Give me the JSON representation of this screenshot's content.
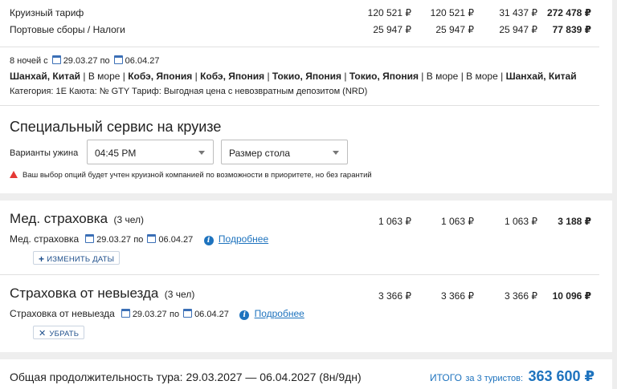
{
  "tariff_rows": [
    {
      "label": "Круизный тариф",
      "values": [
        "120 521 ₽",
        "120 521 ₽",
        "31 437 ₽"
      ],
      "total": "272 478 ₽"
    },
    {
      "label": "Портовые сборы / Налоги",
      "values": [
        "25 947 ₽",
        "25 947 ₽",
        "25 947 ₽"
      ],
      "total": "77 839 ₽"
    }
  ],
  "cruise": {
    "nights_prefix": "8 ночей с",
    "date_from": "29.03.27",
    "by": "по",
    "date_to": "06.04.27",
    "route": [
      {
        "text": "Шанхай, Китай",
        "bold": true
      },
      {
        "text": " | ",
        "bold": false
      },
      {
        "text": "В море",
        "bold": false
      },
      {
        "text": " | ",
        "bold": false
      },
      {
        "text": "Кобэ, Япония",
        "bold": true
      },
      {
        "text": " | ",
        "bold": false
      },
      {
        "text": "Кобэ, Япония",
        "bold": true
      },
      {
        "text": " | ",
        "bold": false
      },
      {
        "text": "Токио, Япония",
        "bold": true
      },
      {
        "text": " | ",
        "bold": false
      },
      {
        "text": "Токио, Япония",
        "bold": true
      },
      {
        "text": " | ",
        "bold": false
      },
      {
        "text": "В море",
        "bold": false
      },
      {
        "text": " | ",
        "bold": false
      },
      {
        "text": "В море",
        "bold": false
      },
      {
        "text": " | ",
        "bold": false
      },
      {
        "text": "Шанхай, Китай",
        "bold": true
      }
    ],
    "details": "Категория: 1E  Каюта: № GTY  Тариф: Выгодная цена с невозвратным депозитом (NRD)"
  },
  "special_service": {
    "title": "Специальный сервис на круизе",
    "dinner_label": "Варианты ужина",
    "dinner_value": "04:45 PM",
    "table_value": "Размер стола",
    "warning": "Ваш выбор опций будет учтен круизной компанией по возможности в приоритете, но без гарантий"
  },
  "med_insurance": {
    "title": "Мед. страховка",
    "people": "(3 чел)",
    "values": [
      "1 063 ₽",
      "1 063 ₽",
      "1 063 ₽"
    ],
    "total": "3 188 ₽",
    "sub_label": "Мед. страховка",
    "date_from": "29.03.27",
    "by": "по",
    "date_to": "06.04.27",
    "more_link": "Подробнее",
    "change_button": "ИЗМЕНИТЬ ДАТЫ"
  },
  "cancel_insurance": {
    "title": "Страховка от невыезда",
    "people": "(3 чел)",
    "values": [
      "3 366 ₽",
      "3 366 ₽",
      "3 366 ₽"
    ],
    "total": "10 096 ₽",
    "sub_label": "Страховка от невыезда",
    "date_from": "29.03.27",
    "by": "по",
    "date_to": "06.04.27",
    "more_link": "Подробнее",
    "remove_button": "УБРАТЬ"
  },
  "footer": {
    "duration": "Общая продолжительность тура: 29.03.2027 — 06.04.2027 (8н/9дн)",
    "total_label": "ИТОГО",
    "total_suffix": "за 3 туристов:",
    "total_value": "363 600 ₽"
  },
  "colors": {
    "accent": "#1e73be",
    "warning": "#e53935"
  }
}
